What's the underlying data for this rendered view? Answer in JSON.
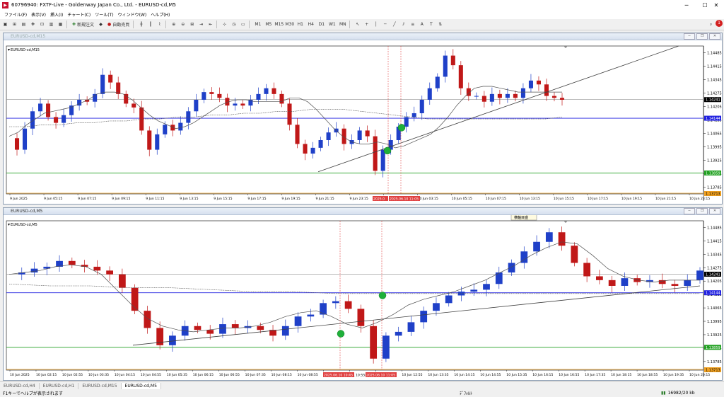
{
  "app": {
    "title": "60796940: FXTF-Live - Goldenway Japan Co., Ltd. - EURUSD-cd,M5",
    "icon_name": "app-logo-icon"
  },
  "menu": [
    "ファイル(F)",
    "表示(V)",
    "挿入(I)",
    "チャート(C)",
    "ツール(T)",
    "ウィンドウ(W)",
    "ヘルプ(H)"
  ],
  "toolbar": {
    "new_order": "新規注文",
    "auto_trade": "自動売買",
    "timeframes": [
      "M1",
      "M5",
      "M15",
      "M30",
      "H1",
      "H4",
      "D1",
      "W1",
      "MN"
    ],
    "notification_count": "1"
  },
  "chart_top": {
    "window_title": "EURUSD-cd,M15",
    "symbol_label": "EURUSD-cd,M15",
    "price_labels": [
      "1.14485",
      "1.14415",
      "1.14345",
      "1.14275",
      "1.14205",
      "1.14135",
      "1.14065",
      "1.13995",
      "1.13925",
      "1.13855",
      "1.13785"
    ],
    "current_price": "1.14241",
    "blue_line_price": "1.14144",
    "green_line_price": "1.13859",
    "orange_tag": "1.13713",
    "time_labels": [
      "9 Jun 2025",
      "9 Jun 05:15",
      "9 Jun 07:15",
      "9 Jun 09:15",
      "9 Jun 11:15",
      "9 Jun 13:15",
      "9 Jun 15:15",
      "9 Jun 17:15",
      "9 Jun 19:15",
      "9 Jun 21:15",
      "9 Jun 23:15",
      "10 Jun 01:15",
      "10 Jun 03:15",
      "10 Jun 05:15",
      "10 Jun 07:15",
      "10 Jun 13:15",
      "10 Jun 15:15",
      "10 Jun 17:15",
      "10 Jun 19:15",
      "10 Jun 21:15",
      "10 Jun 23:15"
    ],
    "vline_labels": [
      "2025.0",
      "2025.06.10 11:05"
    ]
  },
  "chart_bottom": {
    "window_title": "EURUSD-cd,M5",
    "symbol_label": "EURUSD-cd,M5",
    "tooltip": "横軸目盛",
    "price_labels": [
      "1.14485",
      "1.14415",
      "1.14345",
      "1.14275",
      "1.14205",
      "1.14135",
      "1.14065",
      "1.13995",
      "1.13925",
      "1.13855",
      "1.13785"
    ],
    "current_price": "1.14241",
    "blue_line_price": "1.14144",
    "green_line_price": "1.13859",
    "orange_tag": "1.13713",
    "time_labels": [
      "10 Jun 2025",
      "10 Jun 02:15",
      "10 Jun 02:55",
      "10 Jun 03:35",
      "10 Jun 04:15",
      "10 Jun 04:55",
      "10 Jun 05:35",
      "10 Jun 06:15",
      "10 Jun 06:55",
      "10 Jun 07:35",
      "10 Jun 08:15",
      "10 Jun 08:55",
      "10 Jun 09:35",
      "10 Jun 11:35",
      "10 Jun 12:15",
      "10 Jun 12:55",
      "10 Jun 13:35",
      "10 Jun 14:15",
      "10 Jun 14:55",
      "10 Jun 15:35",
      "10 Jun 16:15",
      "10 Jun 16:55",
      "10 Jun 17:35",
      "10 Jun 18:15",
      "10 Jun 18:55",
      "10 Jun 19:35",
      "10 Jun 20:15"
    ],
    "vline_labels": [
      "2025.06.10 10:45",
      "10:55",
      "2025.06.10 11:05"
    ]
  },
  "tabs": [
    "EURUSD-cd,H4",
    "EURUSD-cd,H1",
    "EURUSD-cd,M15",
    "EURUSD-cd,M5"
  ],
  "active_tab": "EURUSD-cd,M5",
  "status": {
    "help": "F1キーでヘルプが表示されます",
    "profile": "ﾃﾞﾌｫﾙﾄ",
    "traffic": "16982/20 kb"
  },
  "colors": {
    "bull": "#1f40c8",
    "bear": "#c01818",
    "ma": "#505050",
    "blue_line": "#2020e0",
    "green_line": "#20a020",
    "marker": "#1fb03a",
    "vline": "#e04040",
    "orange": "#f0a020"
  },
  "chart_data": [
    {
      "type": "candlestick",
      "symbol": "EURUSD-cd",
      "timeframe": "M15",
      "ylim": [
        1.1375,
        1.1452
      ],
      "yticks": [
        1.14485,
        1.14415,
        1.14345,
        1.14275,
        1.14205,
        1.14135,
        1.14065,
        1.13995,
        1.13925,
        1.13855,
        1.13785
      ],
      "horizontal_lines": [
        1.14241,
        1.14144,
        1.13859
      ],
      "path": [
        1.1404,
        1.1398,
        1.1409,
        1.1418,
        1.1422,
        1.1415,
        1.1412,
        1.1416,
        1.1421,
        1.1424,
        1.1423,
        1.1427,
        1.1437,
        1.1433,
        1.1427,
        1.1422,
        1.142,
        1.1408,
        1.1398,
        1.1406,
        1.1411,
        1.1408,
        1.1412,
        1.1418,
        1.1424,
        1.1428,
        1.1427,
        1.1425,
        1.1421,
        1.1422,
        1.1421,
        1.1424,
        1.1427,
        1.143,
        1.1427,
        1.1422,
        1.1411,
        1.1401,
        1.1396,
        1.1399,
        1.1403,
        1.1407,
        1.1409,
        1.1401,
        1.1403,
        1.1408,
        1.1405,
        1.1387,
        1.1398,
        1.1403,
        1.141,
        1.1415,
        1.1417,
        1.1424,
        1.143,
        1.1436,
        1.1447,
        1.1442,
        1.143,
        1.1426,
        1.1426,
        1.1423,
        1.1427,
        1.1425,
        1.1427,
        1.1425,
        1.143,
        1.1434,
        1.1432,
        1.1426,
        1.1425,
        1.1424
      ],
      "ma_fast": [
        1.1405,
        1.1407,
        1.1411,
        1.1414,
        1.1417,
        1.1418,
        1.1419,
        1.142,
        1.1422,
        1.1424,
        1.1427,
        1.1428,
        1.1428,
        1.1427,
        1.1424,
        1.142,
        1.1416,
        1.1413,
        1.1411,
        1.1409,
        1.141,
        1.1412,
        1.1415,
        1.1418,
        1.1421,
        1.1423,
        1.1424,
        1.1424,
        1.1423,
        1.1423,
        1.1423,
        1.1423,
        1.1425,
        1.1425,
        1.1423,
        1.1419,
        1.1414,
        1.1409,
        1.1405,
        1.1402,
        1.1401,
        1.1401,
        1.1402,
        1.1401,
        1.1399,
        1.14,
        1.1402,
        1.1404,
        1.1406,
        1.141,
        1.1415,
        1.1421,
        1.1426,
        1.143,
        1.1431,
        1.1431,
        1.143,
        1.1429,
        1.1428,
        1.1428,
        1.1428,
        1.1428,
        1.1428,
        1.1428
      ],
      "ma_slow": [
        1.141,
        1.141,
        1.1411,
        1.1411,
        1.1412,
        1.1412,
        1.1413,
        1.1413,
        1.1414,
        1.1414,
        1.1415,
        1.1415,
        1.1416,
        1.1416,
        1.1417,
        1.1417,
        1.1418,
        1.1418,
        1.1419,
        1.1419,
        1.1419,
        1.1418,
        1.1417,
        1.1416,
        1.1415,
        1.1414,
        1.1414,
        1.1414,
        1.1414,
        1.1414,
        1.1414,
        1.1414,
        1.1414,
        1.1415
      ]
    },
    {
      "type": "candlestick",
      "symbol": "EURUSD-cd",
      "timeframe": "M5",
      "ylim": [
        1.1374,
        1.1452
      ],
      "yticks": [
        1.14485,
        1.14415,
        1.14345,
        1.14275,
        1.14205,
        1.14135,
        1.14065,
        1.13995,
        1.13925,
        1.13855,
        1.13785
      ],
      "horizontal_lines": [
        1.14241,
        1.14144,
        1.13859
      ],
      "path": [
        1.1424,
        1.1425,
        1.1427,
        1.1428,
        1.1431,
        1.1429,
        1.1428,
        1.1426,
        1.1424,
        1.1417,
        1.1405,
        1.1396,
        1.1387,
        1.1392,
        1.1397,
        1.1395,
        1.1393,
        1.1398,
        1.1396,
        1.1397,
        1.1395,
        1.1392,
        1.1397,
        1.1402,
        1.1403,
        1.1409,
        1.141,
        1.1406,
        1.1397,
        1.138,
        1.1392,
        1.1394,
        1.1399,
        1.1405,
        1.1409,
        1.1413,
        1.1415,
        1.1416,
        1.1419,
        1.1425,
        1.143,
        1.1436,
        1.1441,
        1.1446,
        1.1439,
        1.143,
        1.1423,
        1.1421,
        1.1418,
        1.1422,
        1.142,
        1.1421,
        1.1419,
        1.1418,
        1.1421,
        1.1426
      ],
      "ma_fast": [
        1.1424,
        1.1425,
        1.1426,
        1.1428,
        1.1429,
        1.1428,
        1.1424,
        1.1416,
        1.1408,
        1.1401,
        1.1397,
        1.1395,
        1.1394,
        1.1395,
        1.1396,
        1.1396,
        1.1397,
        1.1399,
        1.1402,
        1.1404,
        1.1405,
        1.1402,
        1.1398,
        1.1396,
        1.1399,
        1.1403,
        1.1408,
        1.1411,
        1.1413,
        1.1415,
        1.1418,
        1.1421,
        1.1425,
        1.1429,
        1.1434,
        1.1438,
        1.1441,
        1.144,
        1.1434,
        1.1427,
        1.1423,
        1.1421,
        1.142,
        1.1421,
        1.1421,
        1.1421
      ],
      "ma_slow": [
        1.1419,
        1.1418,
        1.1418,
        1.1417,
        1.1417,
        1.1416,
        1.1415,
        1.1415,
        1.1414,
        1.1414,
        1.1414,
        1.1414,
        1.1414,
        1.1414,
        1.1414,
        1.1414,
        1.1414,
        1.1414
      ]
    }
  ]
}
